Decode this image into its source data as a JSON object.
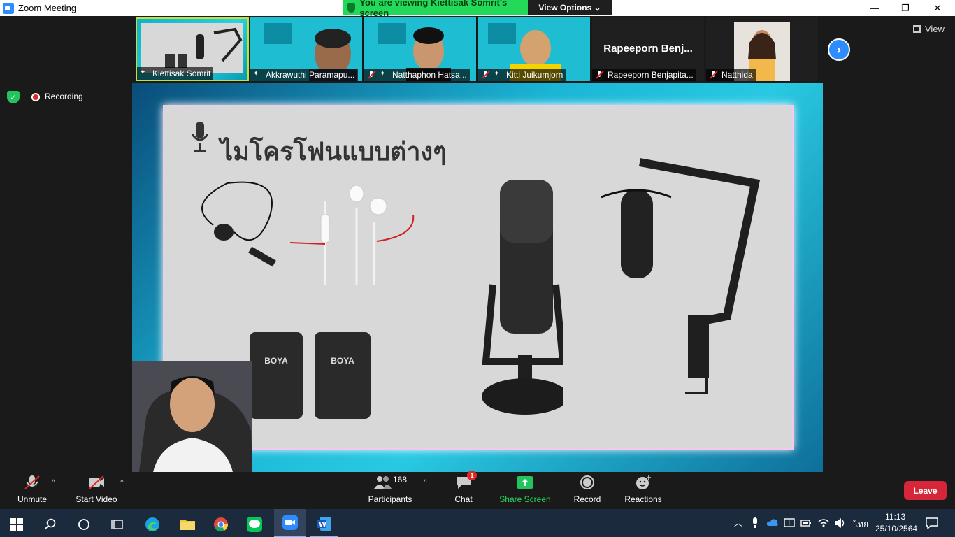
{
  "window": {
    "title": "Zoom Meeting",
    "minimize": "—",
    "restore": "❐",
    "close": "✕"
  },
  "banner": {
    "viewing_text": "You are viewing Kiettisak Somrit's screen",
    "view_options": "View Options ⌄"
  },
  "thumbnails": [
    {
      "name": "Kiettisak Somrit",
      "mic": "pin"
    },
    {
      "name": "Akkrawuthi Paramapu...",
      "mic": "pin"
    },
    {
      "name": "Natthaphon Hatsa...",
      "mic": "muted-pin"
    },
    {
      "name": "Kitti Juikumjorn",
      "mic": "muted-pin"
    },
    {
      "name": "Rapeeporn Benjapita...",
      "mic": "muted",
      "display": "Rapeeporn  Benj..."
    },
    {
      "name": "Natthida",
      "mic": "muted"
    }
  ],
  "view_label": "View",
  "recording_label": "Recording",
  "slide": {
    "title": "ไมโครโฟนแบบต่างๆ",
    "boya1": "BOYA",
    "boya2": "BOYA"
  },
  "toolbar": {
    "unmute": "Unmute",
    "start_video": "Start Video",
    "participants": "Participants",
    "participants_count": "168",
    "chat": "Chat",
    "chat_badge": "1",
    "share_screen": "Share Screen",
    "record": "Record",
    "reactions": "Reactions",
    "leave": "Leave"
  },
  "taskbar": {
    "time": "11:13",
    "date": "25/10/2564",
    "lang": "ไทย"
  },
  "colors": {
    "zoom_blue": "#2d8cff",
    "share_green": "#23d959",
    "leave_red": "#d6263a"
  }
}
